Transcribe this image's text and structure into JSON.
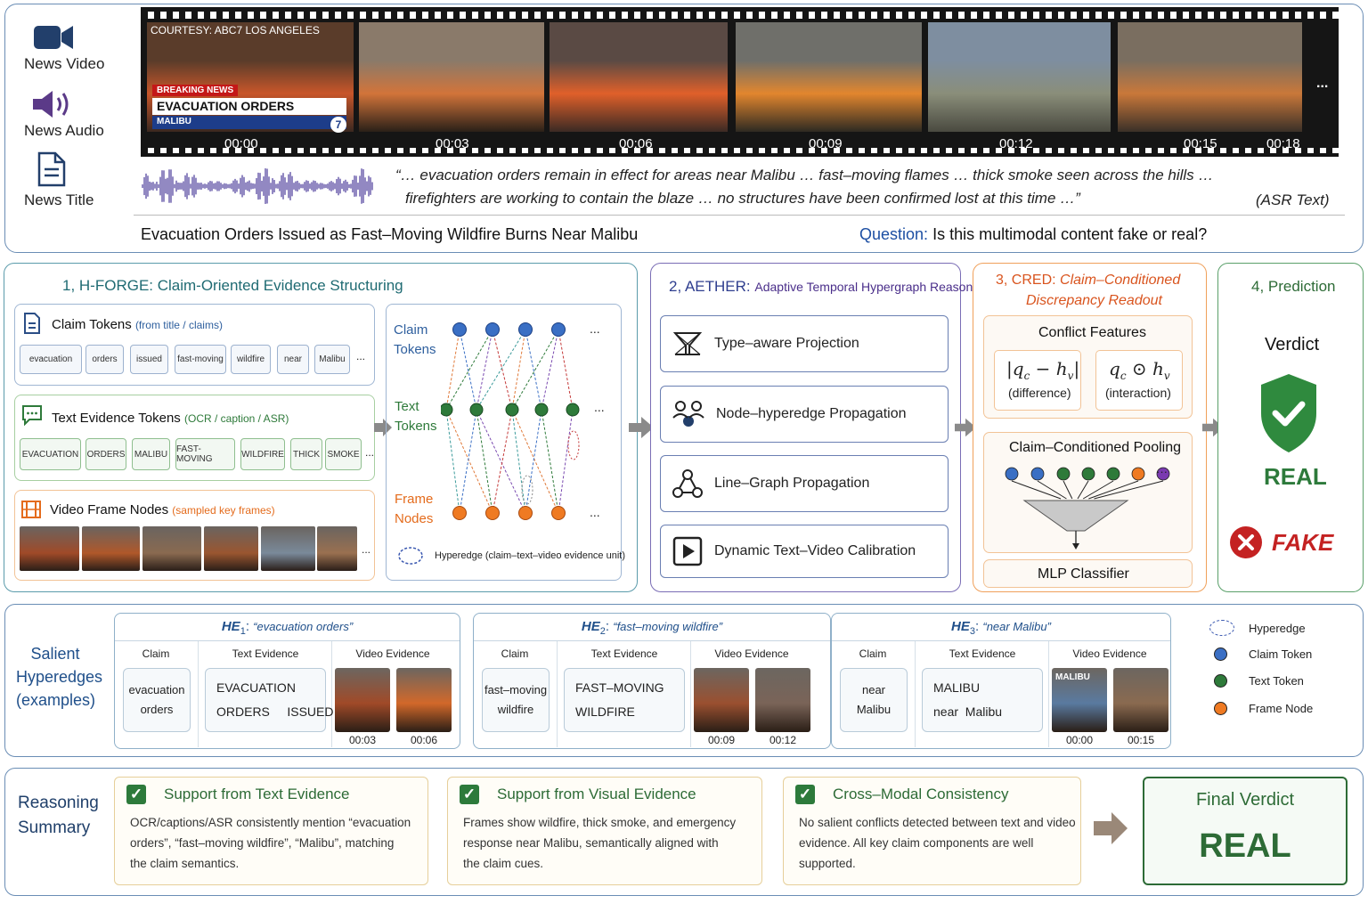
{
  "top": {
    "icons": {
      "video_label": "News Video",
      "audio_label": "News Audio",
      "title_label": "News Title"
    },
    "video_frames": [
      {
        "time": "00:00",
        "colors": [
          "#5a3c2a",
          "#c8562a",
          "#3a2820"
        ]
      },
      {
        "time": "00:03",
        "colors": [
          "#8a7a6a",
          "#d2743a",
          "#2a2018"
        ]
      },
      {
        "time": "00:06",
        "colors": [
          "#5a4a44",
          "#e0602a",
          "#3b2a24"
        ]
      },
      {
        "time": "00:09",
        "colors": [
          "#6f6f6a",
          "#e2862e",
          "#2e2a22"
        ]
      },
      {
        "time": "00:12",
        "colors": [
          "#7e8ea0",
          "#8a8e7a",
          "#4a4a40"
        ]
      },
      {
        "time": "00:15",
        "colors": [
          "#7a6e60",
          "#c9783a",
          "#3a3028"
        ]
      },
      {
        "time": "00:18",
        "colors": []
      }
    ],
    "frame_overlay": {
      "courtesy": "COURTESY: ABC7 LOS ANGELES",
      "breaking": "BREAKING NEWS",
      "headline": "EVACUATION ORDERS ISSUED",
      "location": "MALIBU",
      "logo": "7"
    },
    "more": "...",
    "asr_line1": "“… evacuation orders remain in effect for areas near Malibu … fast–moving flames … thick smoke seen across the hills …",
    "asr_line2": "firefighters are working to contain the blaze …  no structures have been confirmed lost at this time …”",
    "asr_tag": "(ASR Text)",
    "news_title": "Evacuation Orders Issued as Fast–Moving Wildfire Burns Near Malibu",
    "question_label": "Question:",
    "question_text": "Is this multimodal content fake or real?"
  },
  "hforge": {
    "title": "1, H-FORGE: Claim-Oriented Evidence Structuring",
    "claim_title": "Claim Tokens",
    "claim_sub": "(from title / claims)",
    "claim_tokens": [
      "evacuation",
      "orders",
      "issued",
      "fast-moving",
      "wildfire",
      "near",
      "Malibu"
    ],
    "text_title": "Text Evidence Tokens",
    "text_sub": "(OCR / caption / ASR)",
    "text_tokens": [
      "EVACUATION",
      "ORDERS",
      "MALIBU",
      "FAST-MOVING",
      "WILDFIRE",
      "THICK",
      "SMOKE"
    ],
    "frame_title": "Video Frame Nodes",
    "frame_sub": "(sampled key frames)",
    "frame_colors": [
      "#a04a28",
      "#b0582a",
      "#8a6a50",
      "#9a5630",
      "#7a8a9a",
      "#9a7050"
    ],
    "graph_claim": "Claim Tokens",
    "graph_text": "Text Tokens",
    "graph_frame": "Frame Nodes",
    "hyperedge_legend": "Hyperedge (claim–text–video evidence unit)",
    "ellipsis": "..."
  },
  "aether": {
    "num": "2, AETHER:",
    "title": "Adaptive Temporal Hypergraph Reasoning",
    "steps": [
      "Type–aware Projection",
      "Node–hyperedge Propagation",
      "Line–Graph Propagation",
      "Dynamic Text–Video Calibration"
    ]
  },
  "cred": {
    "title1": "3, CRED:",
    "title1b": "Claim–Conditioned",
    "title2": "Discrepancy Readout",
    "conflict_title": "Conflict Features",
    "diff_formula": "|q",
    "diff_label": "(difference)",
    "inter_label": "(interaction)",
    "pool_title": "Claim–Conditioned Pooling",
    "mlp": "MLP Classifier"
  },
  "prediction": {
    "title": "4, Prediction",
    "verdict": "Verdict",
    "real": "REAL",
    "fake": "FAKE"
  },
  "salient": {
    "label1": "Salient",
    "label2": "Hyperedges",
    "label3": "(examples)",
    "col_claim": "Claim",
    "col_text": "Text Evidence",
    "col_video": "Video Evidence",
    "he": [
      {
        "name": "HE",
        "sub": "1",
        "quote": "“evacuation orders”",
        "claim": [
          "evacuation",
          "orders"
        ],
        "text": [
          "EVACUATION",
          "ORDERS     ISSUED"
        ],
        "times": [
          "00:03",
          "00:06"
        ]
      },
      {
        "name": "HE",
        "sub": "2",
        "quote": "“fast–moving wildfire”",
        "claim": [
          "fast–moving",
          "wildfire"
        ],
        "text": [
          "FAST–MOVING",
          "WILDFIRE"
        ],
        "times": [
          "00:09",
          "00:12"
        ]
      },
      {
        "name": "HE",
        "sub": "3",
        "quote": "“near Malibu”",
        "claim": [
          "near",
          "Malibu"
        ],
        "text": [
          "MALIBU",
          "near  Malibu"
        ],
        "times": [
          "00:00",
          "00:15"
        ],
        "frame_text": "MALIBU"
      }
    ],
    "legend": [
      {
        "label": "Hyperedge",
        "color": "#3a58b0"
      },
      {
        "label": "Claim Token",
        "color": "#3a6fc4"
      },
      {
        "label": "Text Token",
        "color": "#2e7a3a"
      },
      {
        "label": "Frame Node",
        "color": "#ef7a22"
      }
    ]
  },
  "summary": {
    "label1": "Reasoning",
    "label2": "Summary",
    "cards": [
      {
        "title": "Support from Text Evidence",
        "lines": [
          "OCR/captions/ASR consistently mention “evacuation",
          "orders”, “fast–moving wildfire”, “Malibu”, matching",
          "the claim semantics."
        ]
      },
      {
        "title": "Support from Visual Evidence",
        "lines": [
          "Frames show wildfire, thick smoke, and emergency",
          "response near Malibu, semantically aligned with",
          "the claim cues."
        ]
      },
      {
        "title": "Cross–Modal Consistency",
        "lines": [
          "No salient conflicts detected between text and video",
          "evidence. All key claim components are well",
          "supported."
        ]
      }
    ],
    "final_title": "Final Verdict",
    "final_value": "REAL"
  }
}
